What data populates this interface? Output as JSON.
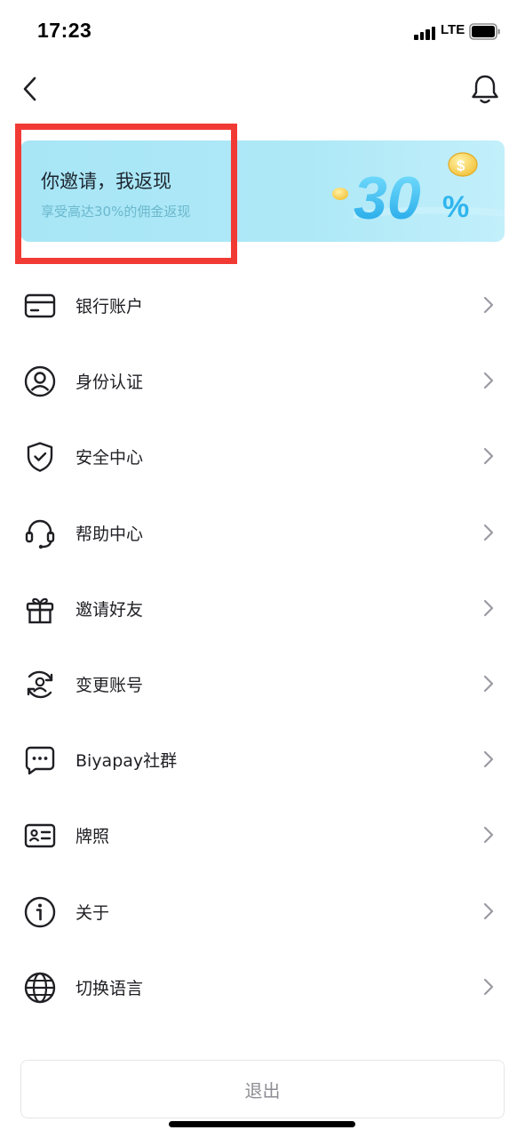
{
  "status_bar": {
    "time": "17:23",
    "network": "LTE"
  },
  "nav": {
    "back_icon": "chevron-left-icon",
    "notification_icon": "bell-icon"
  },
  "banner": {
    "title": "你邀请，我返现",
    "subtitle": "享受高达30%的佣金返现",
    "art_text": "30",
    "art_percent": "%"
  },
  "menu": {
    "items": [
      {
        "label": "银行账户",
        "icon": "bank-card-icon"
      },
      {
        "label": "身份认证",
        "icon": "user-circle-icon"
      },
      {
        "label": "安全中心",
        "icon": "shield-check-icon"
      },
      {
        "label": "帮助中心",
        "icon": "headset-icon"
      },
      {
        "label": "邀请好友",
        "icon": "gift-icon"
      },
      {
        "label": "变更账号",
        "icon": "switch-account-icon"
      },
      {
        "label": "Biyapay社群",
        "icon": "chat-bubble-icon"
      },
      {
        "label": "牌照",
        "icon": "id-card-icon"
      },
      {
        "label": "关于",
        "icon": "info-icon"
      },
      {
        "label": "切换语言",
        "icon": "globe-icon"
      }
    ]
  },
  "logout": {
    "label": "退出"
  },
  "colors": {
    "banner_bg": "#aee8f7",
    "highlight": "#f23a35",
    "text": "#1f1f24",
    "muted": "#8d8d94"
  }
}
